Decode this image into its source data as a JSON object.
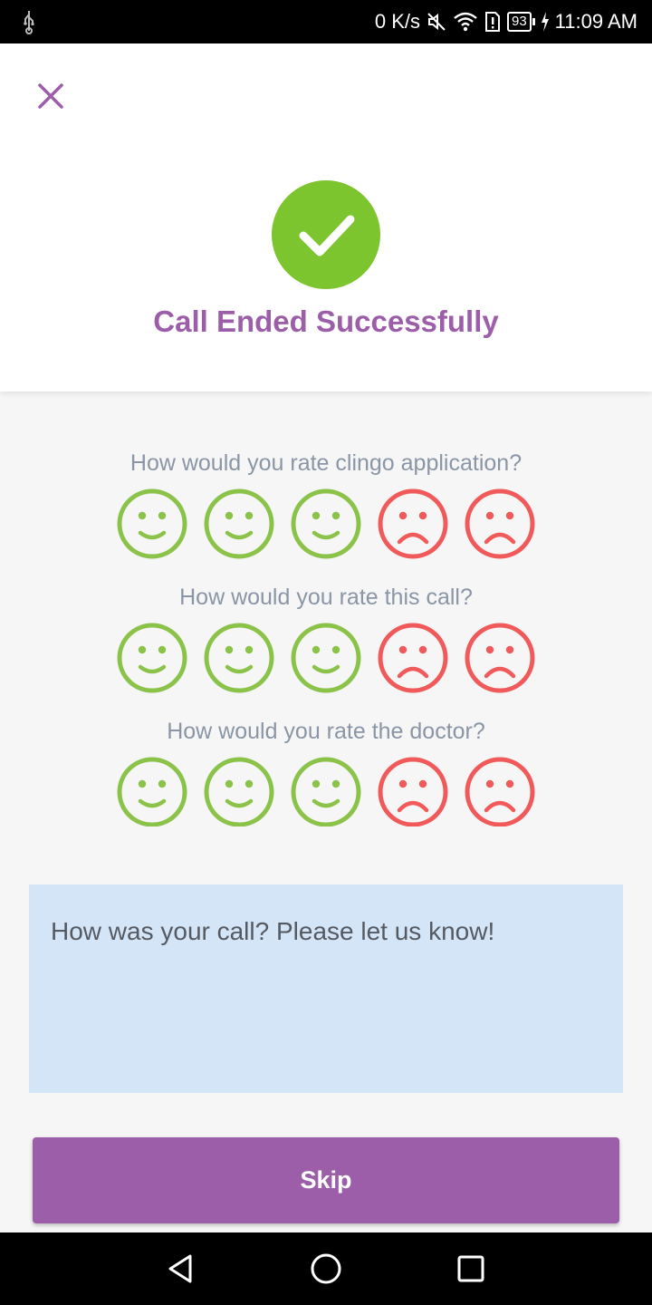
{
  "status_bar": {
    "speed": "0 K/s",
    "battery": "93",
    "time": "11:09 AM",
    "icons": [
      "usb-icon",
      "mute-icon",
      "wifi-icon",
      "sim-alert-icon",
      "battery-icon",
      "charging-icon"
    ]
  },
  "header": {
    "close_icon": "close-icon",
    "check_icon": "check-circle-icon",
    "title": "Call Ended Successfully"
  },
  "ratings": [
    {
      "question": "How would you rate clingo application?",
      "faces": [
        "happy",
        "happy",
        "happy",
        "sad",
        "sad"
      ]
    },
    {
      "question": "How would you rate this call?",
      "faces": [
        "happy",
        "happy",
        "happy",
        "sad",
        "sad"
      ]
    },
    {
      "question": "How would you rate the doctor?",
      "faces": [
        "happy",
        "happy",
        "happy",
        "sad",
        "sad"
      ]
    }
  ],
  "feedback": {
    "placeholder": "How was your call? Please let us know!",
    "value": ""
  },
  "skip_label": "Skip",
  "nav": [
    "back-icon",
    "home-icon",
    "recents-icon"
  ],
  "colors": {
    "accent": "#9c5ea9",
    "success": "#7dc52e",
    "happy": "#8bc34a",
    "sad": "#f05a5a",
    "feedback_bg": "#d4e5f7"
  }
}
